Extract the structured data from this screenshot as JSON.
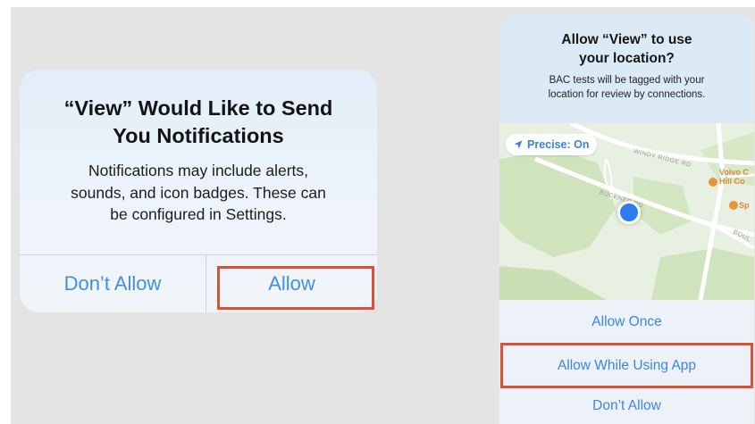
{
  "notification_alert": {
    "title": "“View” Would Like to Send\nYou Notifications",
    "message": "Notifications may include alerts,\nsounds, and icon badges. These can\nbe configured in Settings.",
    "buttons": {
      "dont_allow": "Don’t Allow",
      "allow": "Allow"
    }
  },
  "location_alert": {
    "title": "Allow “View” to use\nyour location?",
    "message": "BAC tests will be tagged with your\nlocation for review by connections.",
    "precise_toggle": "Precise: On",
    "map": {
      "road_labels": [
        "WINDY RIDGE RD",
        "BUCKNER RD",
        "BOUL"
      ],
      "poi_labels": [
        "Volvo C",
        "Hill Co",
        "Sp"
      ]
    },
    "buttons": {
      "allow_once": "Allow Once",
      "allow_while_using": "Allow While Using App",
      "dont_allow": "Don’t Allow"
    }
  },
  "highlight_color": "#d6533a",
  "accent_color": "#3f8fe8"
}
